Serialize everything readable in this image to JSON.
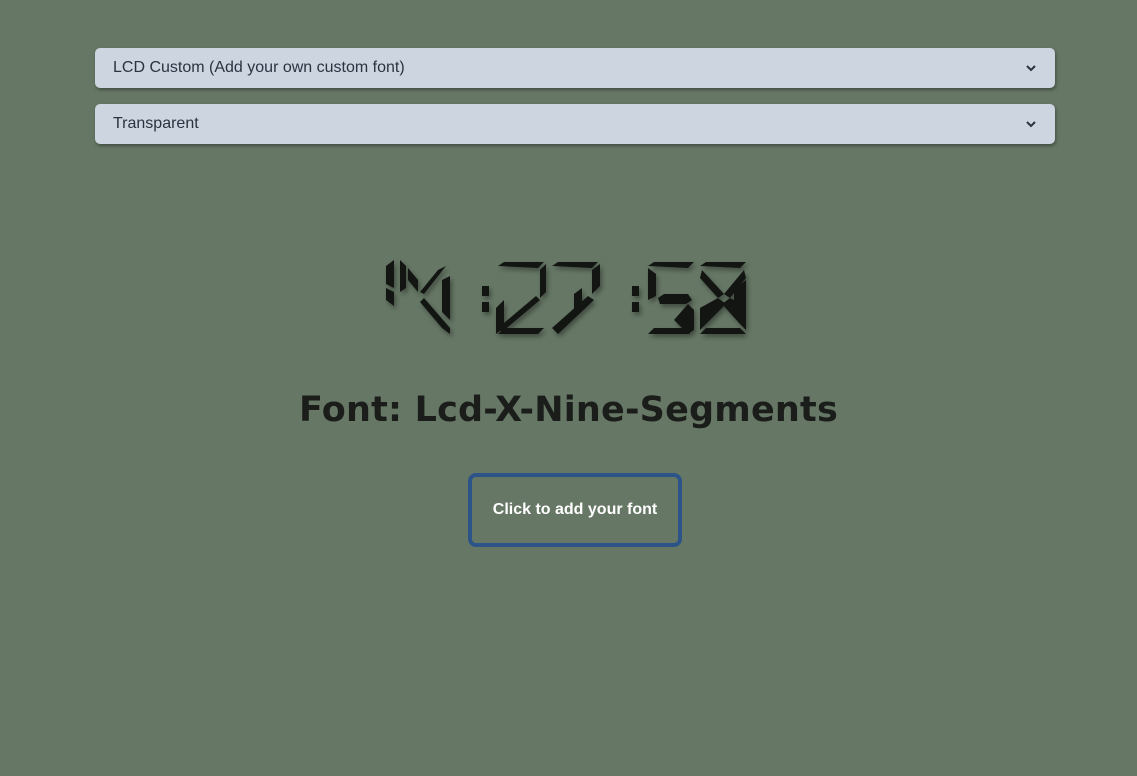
{
  "selects": {
    "font_select": {
      "value": "LCD Custom (Add your own custom font)",
      "icon": "chevron-down-icon"
    },
    "background_select": {
      "value": "Transparent",
      "icon": "chevron-down-icon"
    }
  },
  "clock": {
    "hours": "14",
    "minutes": "27",
    "seconds": "58",
    "segment_color": "#121512"
  },
  "font_label": "Font: Lcd-X-Nine-Segments",
  "add_font_button": {
    "label": "Click to add your font",
    "border_color": "#2d5488"
  },
  "colors": {
    "background": "#667765",
    "select_background": "#ccd5e0",
    "text_dark": "#1a1d1a"
  }
}
